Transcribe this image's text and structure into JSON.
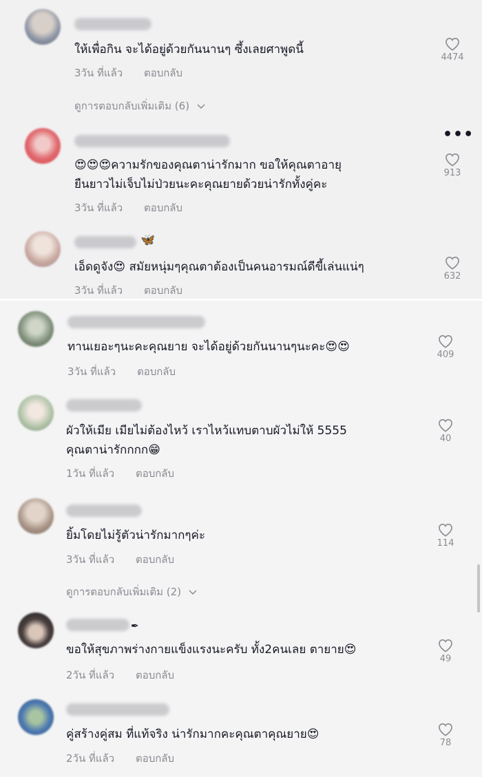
{
  "comments": [
    {
      "text": "ให้เพื่อกิน จะได้อยู่ด้วยกันนานๆ ซึ้งเลยศาพูดนี้",
      "time": "3วัน ที่แล้ว",
      "reply": "ตอบกลับ",
      "likes": "4474"
    },
    {
      "text": "😍😍😍ความรักของคุณตาน่ารักมาก ขอให้คุณตาอายุ\nยืนยาวไม่เจ็บไม่ป่วยนะคะคุณยายด้วยน่ารักทั้งคู่คะ",
      "time": "3วัน ที่แล้ว",
      "reply": "ตอบกลับ",
      "likes": "913"
    },
    {
      "badge": "🦋",
      "text": "เอ็ดดูจัง😍 สมัยหนุ่มๆคุณตาต้องเป็นคนอารมณ์ดีขี้เล่นแน่ๆ",
      "time": "3วัน ที่แล้ว",
      "reply": "ตอบกลับ",
      "likes": "632"
    },
    {
      "text": "ทานเยอะๆนะคะคุณยาย จะได้อยู่ด้วยกันนานๆนะคะ😍😍",
      "time": "3วัน ที่แล้ว",
      "reply": "ตอบกลับ",
      "likes": "409"
    },
    {
      "text": "ผัวให้เมีย เมียไม่ต้องไหว้ เราไหว้แทบตาบผัวไม่ให้ 5555\nคุณตาน่ารักกกก😁",
      "time": "1วัน ที่แล้ว",
      "reply": "ตอบกลับ",
      "likes": "40"
    },
    {
      "text": "ยิ้มโดยไม่รู้ตัวน่ารักมากๆค่ะ",
      "time": "3วัน ที่แล้ว",
      "reply": "ตอบกลับ",
      "likes": "114"
    },
    {
      "badge": "✒",
      "text": "ขอให้สุขภาพร่างกายแข็งแรงนะครับ ทั้ง2คนเลย ตายาย😍",
      "time": "2วัน ที่แล้ว",
      "reply": "ตอบกลับ",
      "likes": "49"
    },
    {
      "text": "คู่สร้างคู่สม ที่แท้จริง น่ารักมากคะคุณตาคุณยาย😍",
      "time": "2วัน ที่แล้ว",
      "reply": "ตอบกลับ",
      "likes": "78"
    }
  ],
  "more_replies": [
    {
      "label": "ดูการตอบกลับเพิ่มเติม (6)"
    },
    {
      "label": "ดูการตอบกลับเพิ่มเติม (2)"
    }
  ],
  "more_options": "•••",
  "icons": {
    "like": "heart-outline-icon",
    "expand": "chevron-down-icon",
    "more": "more-options-icon"
  },
  "colors": {
    "text": "#161823",
    "secondary": "#8a8b91",
    "background": "#f1f1f2"
  }
}
